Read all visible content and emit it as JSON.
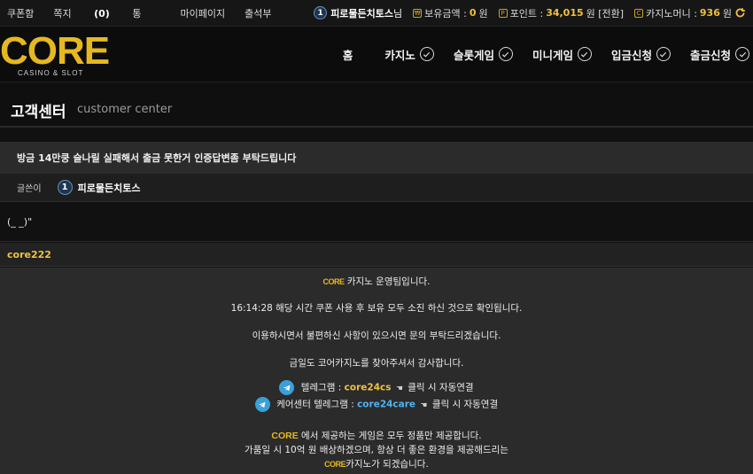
{
  "topbar": {
    "links": [
      "쿠폰함",
      "쪽지",
      "마이페이지",
      "출석부"
    ],
    "message_count": "(0)",
    "message_suffix": "통",
    "user_level": "1",
    "user_name": "피로물든치토스",
    "user_suffix": "님",
    "balance_label": "보유금액 :",
    "balance_value": "0",
    "balance_unit": "원",
    "point_label": "포인트 :",
    "point_value": "34,015",
    "point_unit": "원 [전환]",
    "casino_money_label": "카지노머니 :",
    "casino_money_value": "936",
    "casino_money_unit": "원"
  },
  "header": {
    "logo_text": "CORE",
    "logo_sub": "CASINO & SLOT",
    "nav": [
      "홈",
      "카지노",
      "슬롯게임",
      "미니게임",
      "입금신청",
      "출금신청"
    ]
  },
  "page": {
    "title_ko": "고객센터",
    "title_en": "customer center"
  },
  "post": {
    "subject": "방금 14만쿵 슬나릴 실패해서 출금 못한거 인증답변좀 부탁드립니다",
    "author_label": "글쓴이",
    "author_level": "1",
    "author_name": "피로물든치토스",
    "body": "(_ _)\""
  },
  "reply": {
    "author": "core222",
    "line1": "카지노 운영팀입니다.",
    "line2": "16:14:28 해당 시간 쿠폰 사용 후 보유 모두 소진 하신 것으로 확인됩니다.",
    "line3": "이용하시면서 불편하신 사항이 있으시면 문의 부탁드리겠습니다.",
    "line4": "금일도 코어카지노를 찾아주셔서 감사합니다.",
    "tg1_label": "텔레그램 :",
    "tg1_id": "core24cs",
    "tg1_suffix": "클릭 시 자동연결",
    "tg2_label": "케어센터 텔레그램 :",
    "tg2_id": "core24care",
    "tg2_suffix": "클릭 시 자동연결",
    "line5_brand": "CORE",
    "line5": "에서 제공하는 게임은 모두 정품만 제공합니다.",
    "line6": "가품일 시 10억 원 배상하겠으며, 항상 더 좋은 환경을 제공해드리는",
    "line7": "카지노가 되겠습니다.",
    "mini_logo": "CORE"
  },
  "colors": {
    "accent_gold": "#f0c040",
    "accent_blue": "#4fb3f0",
    "telegram": "#3aa0d8"
  }
}
